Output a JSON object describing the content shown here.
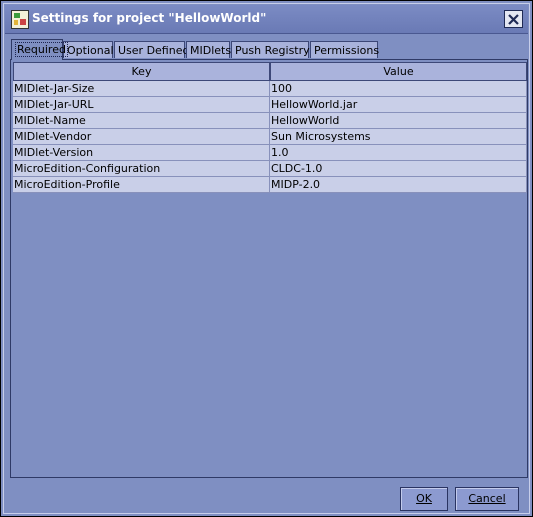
{
  "window": {
    "title": "Settings for project \"HellowWorld\""
  },
  "tabs": [
    {
      "label": "Required",
      "active": true
    },
    {
      "label": "Optional",
      "active": false
    },
    {
      "label": "User Defined",
      "active": false
    },
    {
      "label": "MIDlets",
      "active": false
    },
    {
      "label": "Push Registry",
      "active": false
    },
    {
      "label": "Permissions",
      "active": false
    }
  ],
  "table": {
    "columns": [
      "Key",
      "Value"
    ],
    "rows": [
      {
        "key": "MIDlet-Jar-Size",
        "value": "100"
      },
      {
        "key": "MIDlet-Jar-URL",
        "value": "HellowWorld.jar"
      },
      {
        "key": "MIDlet-Name",
        "value": "HellowWorld"
      },
      {
        "key": "MIDlet-Vendor",
        "value": "Sun Microsystems"
      },
      {
        "key": "MIDlet-Version",
        "value": "1.0"
      },
      {
        "key": "MicroEdition-Configuration",
        "value": "CLDC-1.0"
      },
      {
        "key": "MicroEdition-Profile",
        "value": "MIDP-2.0"
      }
    ]
  },
  "buttons": {
    "ok_label": "OK",
    "cancel_label": "Cancel"
  }
}
